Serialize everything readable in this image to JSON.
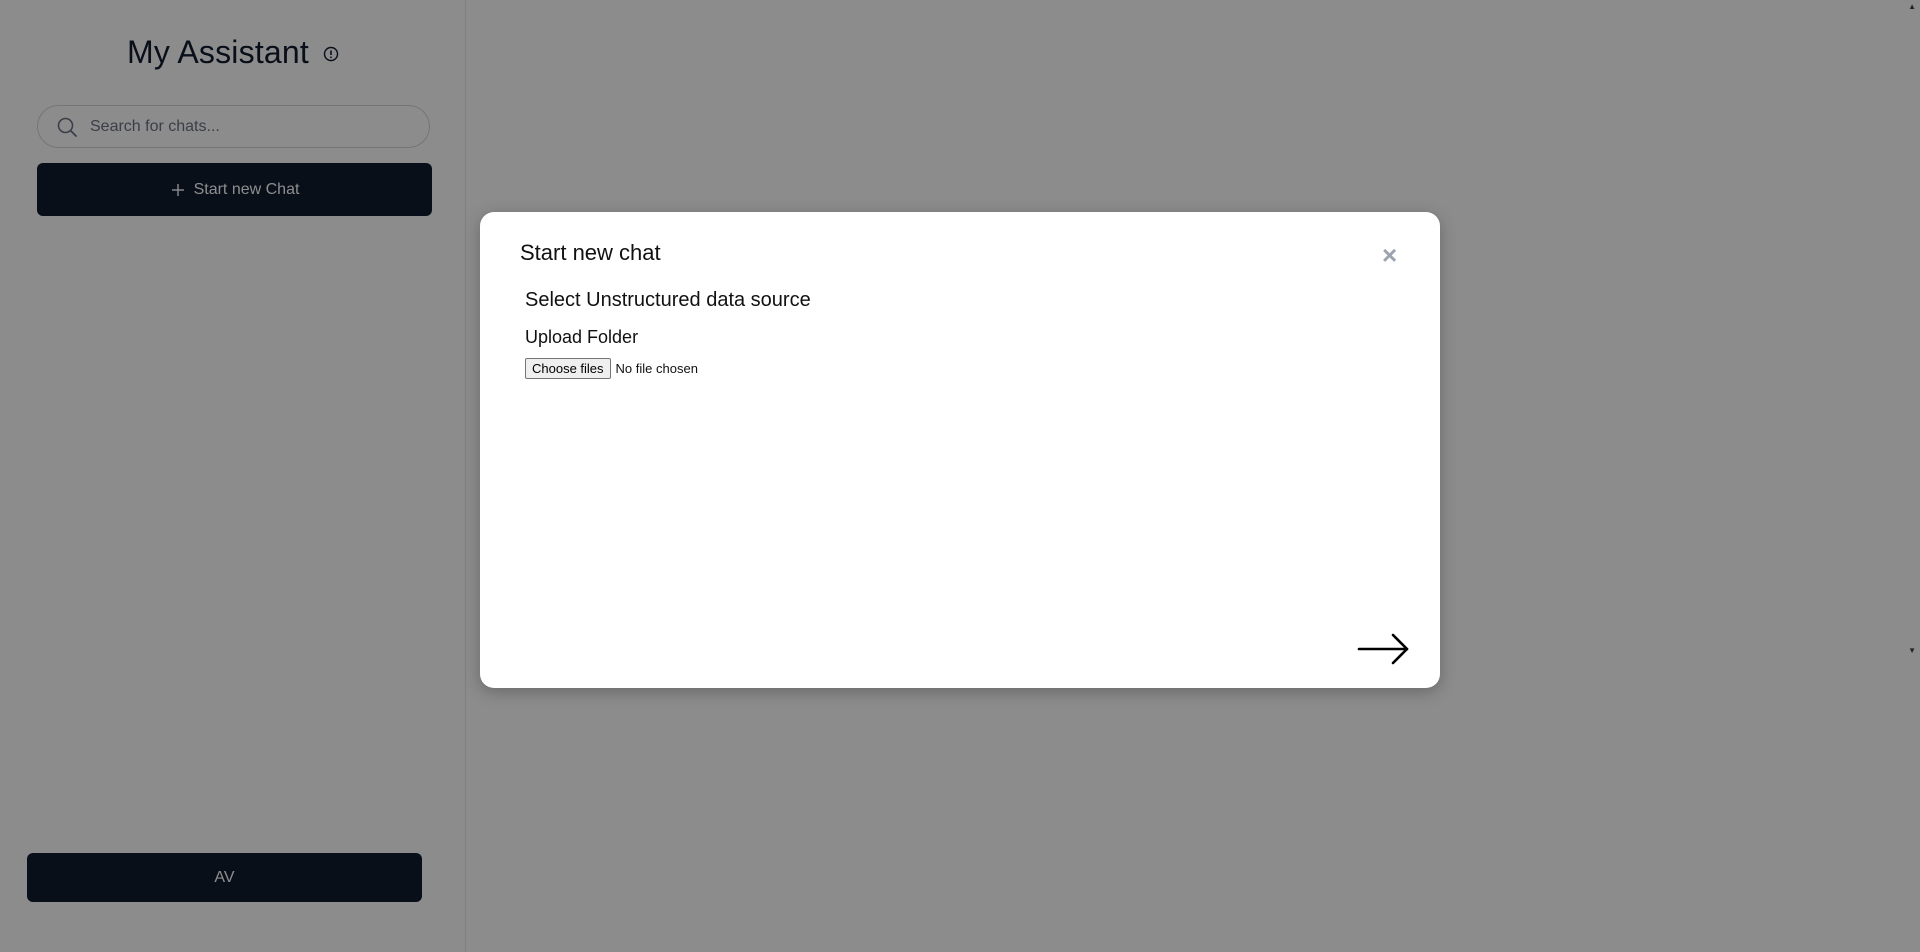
{
  "sidebar": {
    "app_title": "My Assistant",
    "search": {
      "placeholder": "Search for chats...",
      "value": ""
    },
    "new_chat_label": "Start new Chat",
    "user_label": "AV"
  },
  "modal": {
    "title": "Start new chat",
    "close_symbol": "×",
    "section_title": "Select Unstructured data source",
    "upload_label": "Upload Folder",
    "choose_button_label": "Choose files",
    "file_status": "No file chosen"
  },
  "icons": {
    "info": "info-icon",
    "search": "search-icon",
    "plus": "plus-icon",
    "close": "close-icon",
    "next": "arrow-right-icon"
  },
  "colors": {
    "primary": "#0f1d2e",
    "overlay": "rgba(0,0,0,0.45)",
    "muted": "#9ca3af"
  }
}
